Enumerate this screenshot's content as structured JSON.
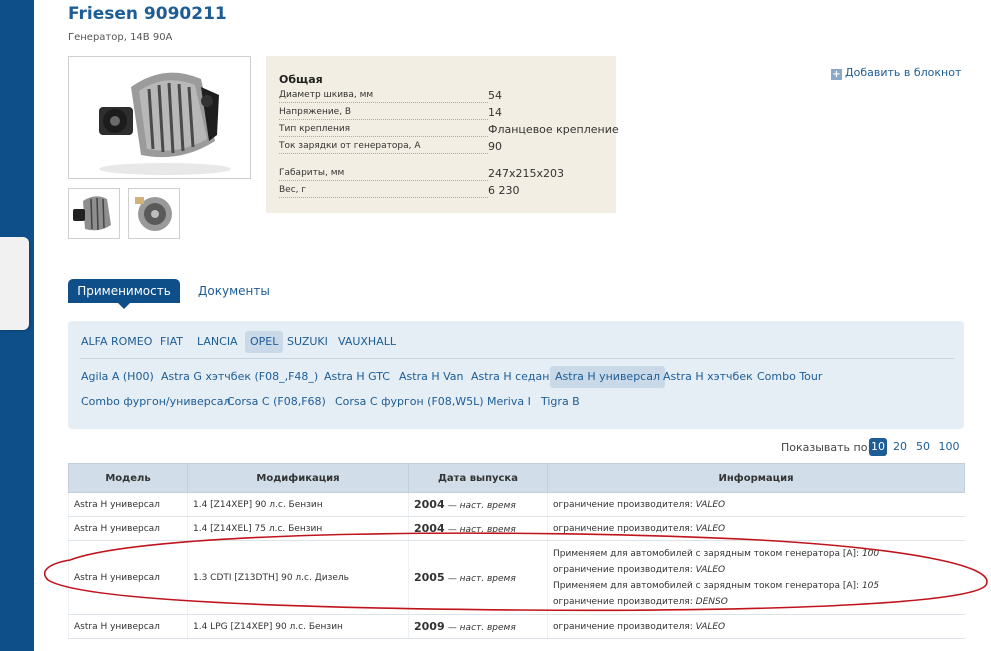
{
  "product": {
    "title": "Friesen 9090211",
    "subtitle": "Генератор, 14В 90А"
  },
  "specs": {
    "title": "Общая",
    "rows": [
      {
        "label": "Диаметр шкива, мм",
        "value": "54"
      },
      {
        "label": "Напряжение, В",
        "value": "14"
      },
      {
        "label": "Тип крепления",
        "value": "Фланцевое крепление"
      },
      {
        "label": "Ток зарядки от генератора, А",
        "value": "90"
      },
      {
        "label": "Габариты, мм",
        "value": "247x215x203"
      },
      {
        "label": "Вес, г",
        "value": "6 230"
      }
    ]
  },
  "actions": {
    "add_to_notebook": "Добавить в блокнот"
  },
  "tabs": {
    "applicability": "Применимость",
    "documents": "Документы"
  },
  "brands": [
    {
      "label": "ALFA ROMEO",
      "selected": false
    },
    {
      "label": "FIAT",
      "selected": false
    },
    {
      "label": "LANCIA",
      "selected": false
    },
    {
      "label": "OPEL",
      "selected": true
    },
    {
      "label": "SUZUKI",
      "selected": false
    },
    {
      "label": "VAUXHALL",
      "selected": false
    }
  ],
  "models": [
    {
      "label": "Agila A (H00)",
      "selected": false
    },
    {
      "label": "Astra G хэтчбек (F08_,F48_)",
      "selected": false
    },
    {
      "label": "Astra H GTC",
      "selected": false
    },
    {
      "label": "Astra H Van",
      "selected": false
    },
    {
      "label": "Astra H седан",
      "selected": false
    },
    {
      "label": "Astra H универсал",
      "selected": true
    },
    {
      "label": "Astra H хэтчбек",
      "selected": false
    },
    {
      "label": "Combo Tour",
      "selected": false
    },
    {
      "label": "Combo фургон/универсал",
      "selected": false
    },
    {
      "label": "Corsa C (F08,F68)",
      "selected": false
    },
    {
      "label": "Corsa C фургон (F08,W5L)",
      "selected": false
    },
    {
      "label": "Meriva I",
      "selected": false
    },
    {
      "label": "Tigra B",
      "selected": false
    }
  ],
  "pagination": {
    "label": "Показывать по:",
    "options": [
      "10",
      "20",
      "50",
      "100"
    ],
    "selected": "10"
  },
  "table": {
    "headers": {
      "model": "Модель",
      "modification": "Модификация",
      "date": "Дата выпуска",
      "info": "Информация"
    },
    "date_end_label": "— наст. время",
    "rows": [
      {
        "model": "Astra H универсал",
        "modification": "1.4 [Z14XEP] 90 л.с. Бензин",
        "year": "2004",
        "info": [
          {
            "label": "ограничение производителя:",
            "value": "VALEO"
          }
        ]
      },
      {
        "model": "Astra H универсал",
        "modification": "1.4 [Z14XEL] 75 л.с. Бензин",
        "year": "2004",
        "info": [
          {
            "label": "ограничение производителя:",
            "value": "VALEO"
          }
        ]
      },
      {
        "model": "Astra H универсал",
        "modification": "1.3 CDTI [Z13DTH] 90 л.с. Дизель",
        "year": "2005",
        "info": [
          {
            "label": "Применяем для автомобилей с зарядным током генератора [A]:",
            "value": "100"
          },
          {
            "label": "ограничение производителя:",
            "value": "VALEO"
          },
          {
            "label": "Применяем для автомобилей с зарядным током генератора [A]:",
            "value": "105"
          },
          {
            "label": "ограничение производителя:",
            "value": "DENSO"
          }
        ]
      },
      {
        "model": "Astra H универсал",
        "modification": "1.4 LPG [Z14XEP] 90 л.с. Бензин",
        "year": "2009",
        "info": [
          {
            "label": "ограничение производителя:",
            "value": "VALEO"
          }
        ]
      }
    ]
  },
  "colors": {
    "brand_blue": "#0e4f8a",
    "link_blue": "#1d5d96",
    "annotation_red": "#c0141c"
  }
}
